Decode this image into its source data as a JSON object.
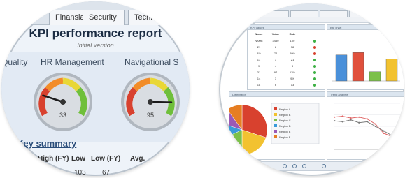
{
  "left_view": {
    "tabs": [
      "Finansial",
      "Security",
      "Technical"
    ],
    "title": "KPI performance report",
    "subtitle": "Initial version",
    "sections": [
      "Quality",
      "HR Management",
      "Navigational S"
    ],
    "gauges": [
      {
        "name": "HR Management",
        "value": 33,
        "needle_fraction": 0.2
      },
      {
        "name": "Navigational S",
        "value": 95,
        "needle_fraction": 0.88
      }
    ],
    "summary_title": "Key summary",
    "summary_columns": [
      "High (FY)",
      "Low",
      "Low (FY)",
      "Avg."
    ],
    "summary_values": [
      "103",
      "67"
    ],
    "colors": {
      "red": "#d8412e",
      "orange": "#f28c28",
      "yellow": "#e9d736",
      "green": "#6fbf3a",
      "title": "#1b2c43",
      "link": "#2a4d7a"
    }
  },
  "right_view": {
    "panel_titles": [
      "KPI Values",
      "Bar chart",
      "Distribution",
      "Trend analysis"
    ],
    "table_headers": [
      "Name",
      "Value",
      "Rate"
    ],
    "table_rows": [
      {
        "name": "NAME",
        "value": "4450",
        "rate": "100",
        "status": "green"
      },
      {
        "name": "21",
        "value": "8",
        "rate": "38",
        "status": "red"
      },
      {
        "name": "4%",
        "value": "74",
        "rate": "40%",
        "status": "red"
      },
      {
        "name": "13",
        "value": "3",
        "rate": "21",
        "status": "green"
      },
      {
        "name": "9",
        "value": "4",
        "rate": "8",
        "status": "green"
      },
      {
        "name": "31",
        "value": "97",
        "rate": "13%",
        "status": "green"
      },
      {
        "name": "14",
        "value": "3",
        "rate": "9%",
        "status": "green"
      },
      {
        "name": "18",
        "value": "6",
        "rate": "13",
        "status": "green"
      }
    ],
    "status_colors": {
      "green": "#3cb043",
      "red": "#d8412e"
    },
    "bar_chart": {
      "type": "bar",
      "values": [
        0.62,
        0.68,
        0.22,
        0.52
      ],
      "colors": [
        "#4a90d9",
        "#e0503c",
        "#7cc04a",
        "#f2c230"
      ]
    },
    "pie_chart": {
      "type": "pie",
      "values": [
        30,
        20,
        18,
        12,
        10,
        10
      ],
      "colors": [
        "#d8412e",
        "#f2c230",
        "#7cc04a",
        "#3a9ad9",
        "#9b59b6",
        "#e67e22"
      ]
    },
    "legend_items": [
      "Region A",
      "Region B",
      "Region C",
      "Region D",
      "Region E",
      "Region F"
    ],
    "line_chart": {
      "type": "line",
      "series": [
        {
          "values": [
            0.7,
            0.72,
            0.68,
            0.7,
            0.66,
            0.55,
            0.35,
            0.28,
            0.22
          ],
          "color": "#e06666"
        },
        {
          "values": [
            0.62,
            0.6,
            0.64,
            0.58,
            0.6,
            0.5,
            0.4,
            0.3,
            0.26
          ],
          "color": "#7a7a7a"
        }
      ]
    }
  }
}
